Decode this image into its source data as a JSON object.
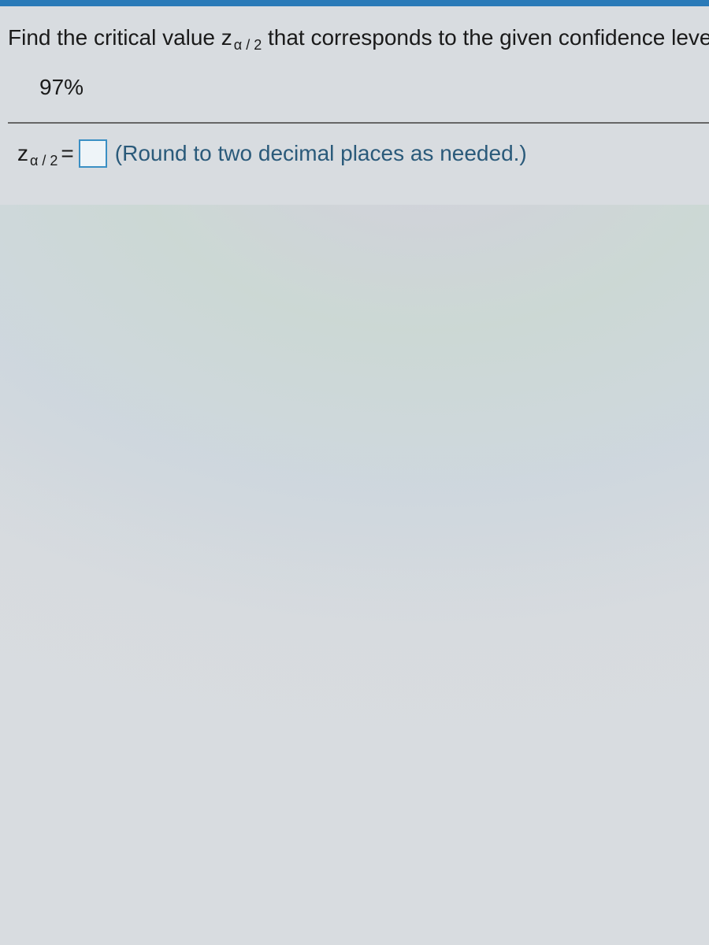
{
  "question": {
    "prompt_prefix": "Find the critical value z",
    "prompt_subscript": "α / 2",
    "prompt_suffix": " that corresponds to the given confidence leve",
    "confidence_level": "97%"
  },
  "answer": {
    "label_z": "z",
    "label_subscript": "α / 2",
    "equals": "=",
    "input_value": "",
    "hint": "(Round to two decimal places as needed.)"
  }
}
